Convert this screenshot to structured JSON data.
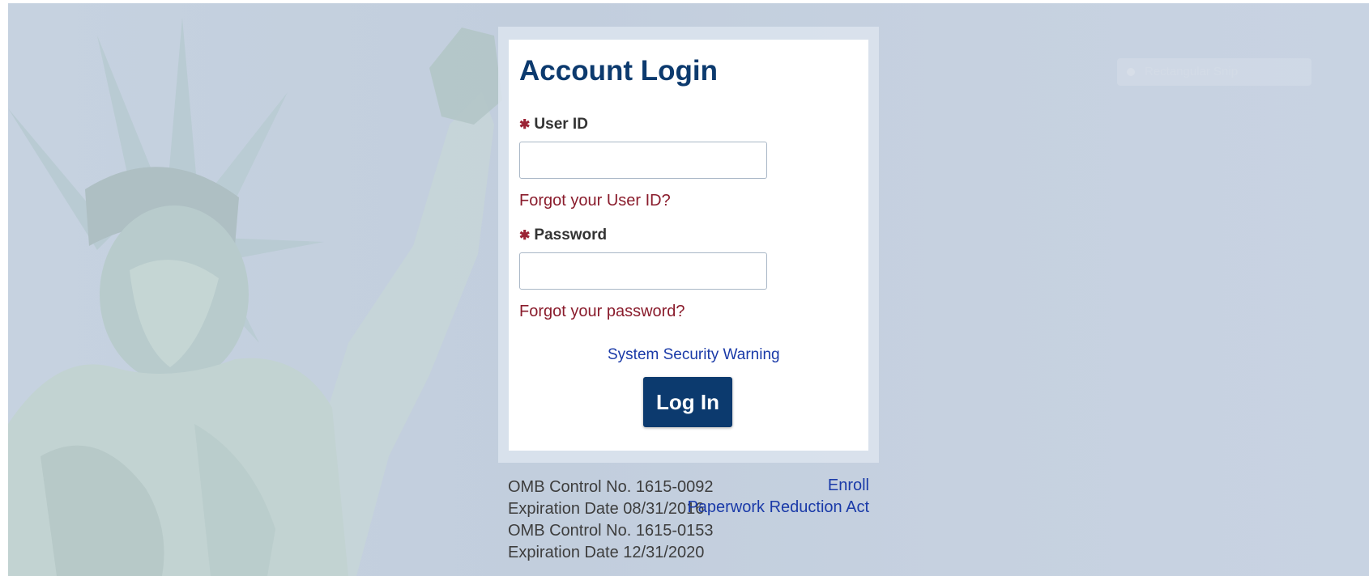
{
  "login": {
    "title": "Account Login",
    "required_mark": "✱",
    "user_id_label": "User ID",
    "user_id_value": "",
    "user_id_placeholder": "",
    "forgot_user_id": "Forgot your User ID?",
    "password_label": "Password",
    "password_value": "",
    "password_placeholder": "",
    "forgot_password": "Forgot your password?",
    "security_warning": "System Security Warning",
    "login_button": "Log In"
  },
  "footer": {
    "omb_lines": [
      "OMB Control No. 1615-0092",
      "Expiration Date 08/31/2016",
      "OMB Control No. 1615-0153",
      "Expiration Date 12/31/2020"
    ],
    "enroll": "Enroll",
    "paperwork": "Paperwork Reduction Act"
  },
  "overlay": {
    "snip_label": "Rectangular Snip"
  },
  "colors": {
    "title": "#0c3a6e",
    "button_bg": "#0c3a6e",
    "link_red": "#8a1c2c",
    "link_blue": "#1a3aa8",
    "required": "#9b2335",
    "background": "#c4d0df"
  },
  "background_image": "statue-of-liberty-photo"
}
